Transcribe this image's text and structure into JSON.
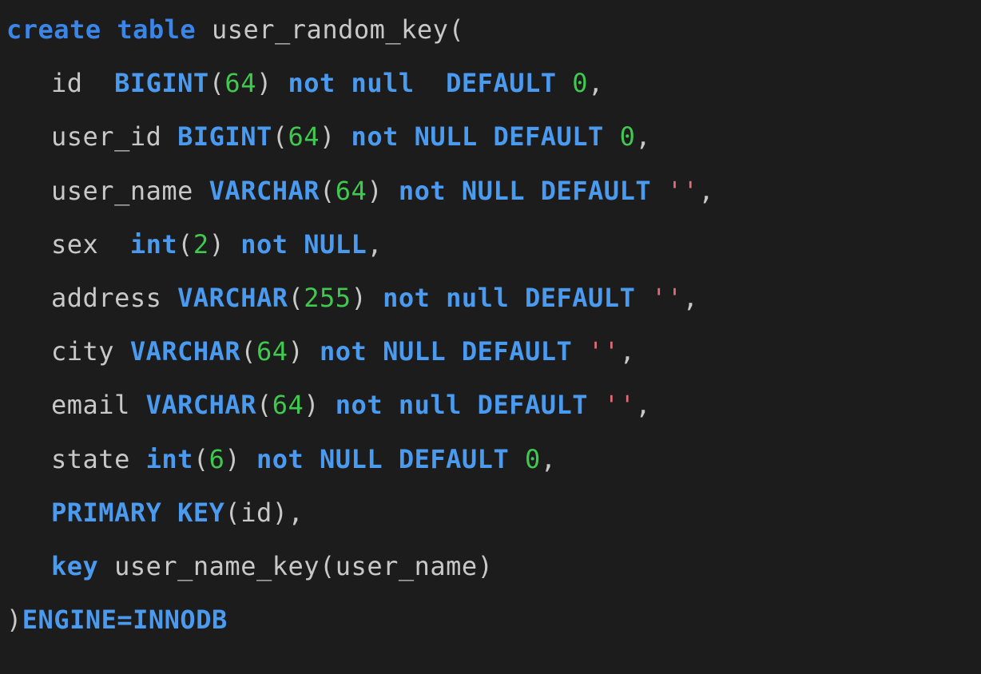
{
  "sql": {
    "create": "create",
    "table": "table",
    "table_name": "user_random_key",
    "open_paren": "(",
    "close_paren": ")",
    "columns": [
      {
        "name": "id",
        "name_pad": "  ",
        "type": "BIGINT",
        "size": "64",
        "not": "not",
        "null": "null",
        "pad2": "  ",
        "default_kw": "DEFAULT",
        "default_val": "0",
        "comma": ","
      },
      {
        "name": "user_id",
        "name_pad": " ",
        "type": "BIGINT",
        "size": "64",
        "not": "not",
        "null": "NULL",
        "pad2": " ",
        "default_kw": "DEFAULT",
        "default_val": "0",
        "comma": ","
      },
      {
        "name": "user_name",
        "name_pad": " ",
        "type": "VARCHAR",
        "size": "64",
        "not": "not",
        "null": "NULL",
        "pad2": " ",
        "default_kw": "DEFAULT",
        "default_str": "''",
        "comma": ","
      },
      {
        "name": "sex",
        "name_pad": "  ",
        "type": "int",
        "size": "2",
        "not": "not",
        "null": "NULL",
        "comma": ","
      },
      {
        "name": "address",
        "name_pad": " ",
        "type": "VARCHAR",
        "size": "255",
        "not": "not",
        "null": "null",
        "pad2": " ",
        "default_kw": "DEFAULT",
        "default_str": "''",
        "comma": ","
      },
      {
        "name": "city",
        "name_pad": " ",
        "type": "VARCHAR",
        "size": "64",
        "not": "not",
        "null": "NULL",
        "pad2": " ",
        "default_kw": "DEFAULT",
        "default_str": "''",
        "comma": ","
      },
      {
        "name": "email",
        "name_pad": " ",
        "type": "VARCHAR",
        "size": "64",
        "not": "not",
        "null": "null",
        "pad2": " ",
        "default_kw": "DEFAULT",
        "default_str": "''",
        "comma": ","
      },
      {
        "name": "state",
        "name_pad": " ",
        "type": "int",
        "size": "6",
        "not": "not",
        "null": "NULL",
        "pad2": " ",
        "default_kw": "DEFAULT",
        "default_val": "0",
        "comma": ","
      }
    ],
    "pk": {
      "primary": "PRIMARY",
      "key": "KEY",
      "col": "id",
      "comma": ","
    },
    "idx": {
      "key": "key",
      "name": "user_name_key",
      "col": "user_name"
    },
    "engine": {
      "eq": "ENGINE=INNODB"
    }
  }
}
